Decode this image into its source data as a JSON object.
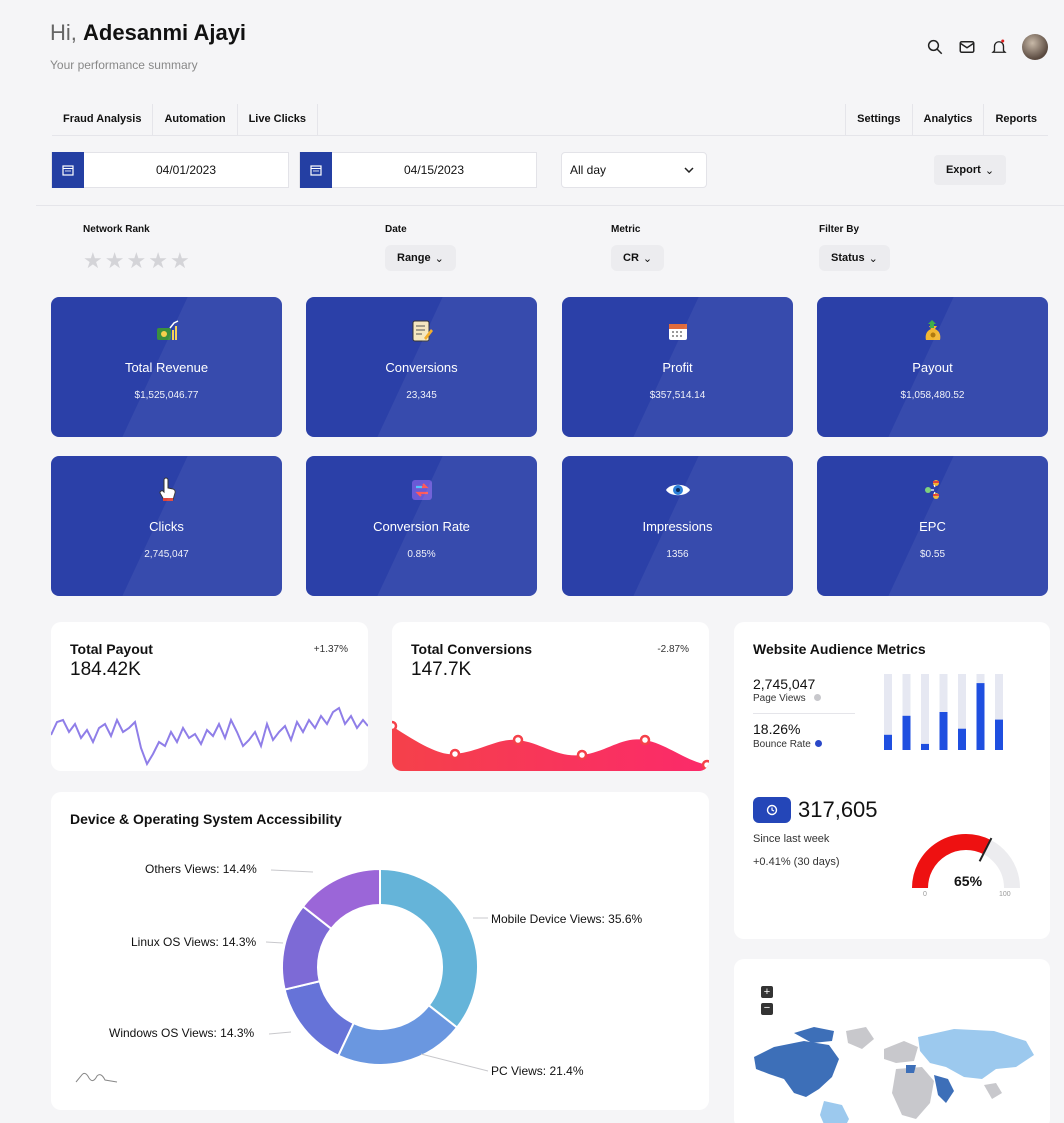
{
  "header": {
    "greeting": "Hi,",
    "name": "Adesanmi Ajayi",
    "subtitle": "Your performance summary"
  },
  "icons": [
    "search-icon",
    "mail-icon",
    "bell-icon",
    "avatar"
  ],
  "tabs_left": [
    "Fraud Analysis",
    "Automation",
    "Live Clicks"
  ],
  "tabs_right": [
    "Settings",
    "Analytics",
    "Reports"
  ],
  "date_from": "04/01/2023",
  "date_to": "04/15/2023",
  "time_select": "All day",
  "export_label": "Export",
  "filters": {
    "network_rank": "Network Rank",
    "date": "Date",
    "date_value": "Range",
    "metric": "Metric",
    "metric_value": "CR",
    "filter_by": "Filter By",
    "filter_value": "Status",
    "stars": 0
  },
  "cards": [
    {
      "title": "Total Revenue",
      "value": "$1,525,046.77",
      "icon": "money-chart-icon"
    },
    {
      "title": "Conversions",
      "value": "23,345",
      "icon": "document-pen-icon"
    },
    {
      "title": "Profit",
      "value": "$357,514.14",
      "icon": "calendar-icon"
    },
    {
      "title": "Payout",
      "value": "$1,058,480.52",
      "icon": "money-bag-icon"
    },
    {
      "title": "Clicks",
      "value": "2,745,047",
      "icon": "pointer-hand-icon"
    },
    {
      "title": "Conversion Rate",
      "value": "0.85%",
      "icon": "exchange-arrows-icon"
    },
    {
      "title": "Impressions",
      "value": "1356",
      "icon": "eye-icon"
    },
    {
      "title": "EPC",
      "value": "$0.55",
      "icon": "users-network-icon"
    }
  ],
  "payout": {
    "title": "Total Payout",
    "value": "184.42K",
    "change": "+1.37%"
  },
  "conversions": {
    "title": "Total Conversions",
    "value": "147.7K",
    "change": "-2.87%"
  },
  "audience": {
    "title": "Website Audience Metrics",
    "page_views": "2,745,047",
    "page_views_label": "Page Views",
    "bounce_rate": "18.26%",
    "bounce_label": "Bounce Rate",
    "counter": "317,605",
    "since": "Since last week",
    "change": "+0.41% (30 days)",
    "gauge_value": "65%",
    "gauge_min": "0",
    "gauge_max": "100",
    "gauge_fraction": 0.65,
    "bars": [
      0.2,
      0.45,
      0.08,
      0.5,
      0.28,
      0.88,
      0.4
    ]
  },
  "device": {
    "title": "Device & Operating System Accessibility",
    "labels": {
      "others": "Others Views: 14.4%",
      "linux": "Linux OS Views: 14.3%",
      "windows": "Windows OS Views: 14.3%",
      "mobile": "Mobile Device Views: 35.6%",
      "pc": "PC Views: 21.4%"
    }
  },
  "chart_data": [
    {
      "type": "pie",
      "categories": [
        "Mobile Device Views",
        "PC Views",
        "Windows OS Views",
        "Linux OS Views",
        "Others Views"
      ],
      "values": [
        35.6,
        21.4,
        14.3,
        14.3,
        14.4
      ]
    }
  ],
  "colors": {
    "brand": "#2b40a8",
    "donut": [
      "#65b4d9",
      "#6a97e0",
      "#6673d8",
      "#7d6ad6",
      "#9b66d8"
    ]
  },
  "map": {
    "zoom_in": "+",
    "zoom_out": "−"
  }
}
